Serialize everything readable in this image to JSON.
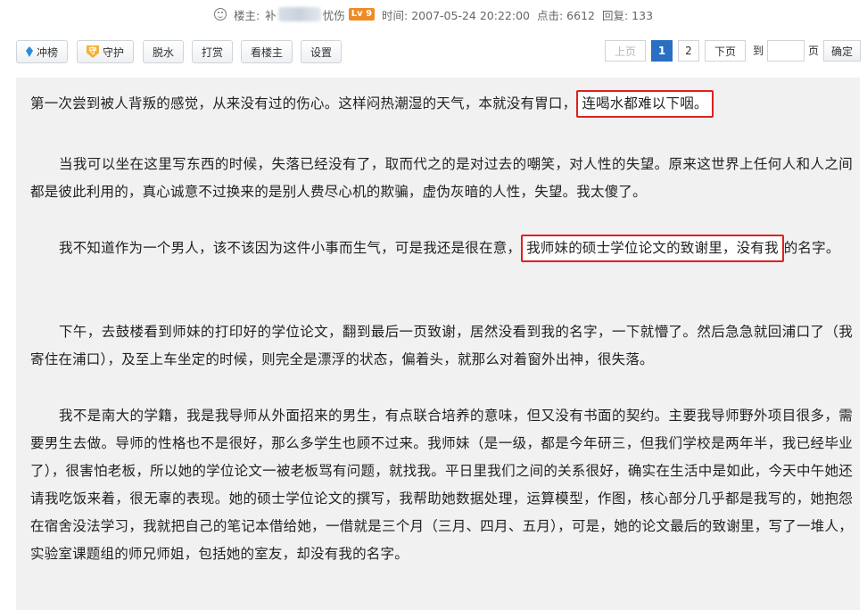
{
  "meta": {
    "author_label": "楼主:",
    "author_prefix": "补",
    "author_suffix": "忧伤",
    "level": "Lv 9",
    "time": "时间: 2007-05-24 20:22:00",
    "clicks": "点击: 6612",
    "replies": "回复: 133"
  },
  "toolbar": {
    "buttons": [
      {
        "label": "冲榜",
        "icon": "gem-icon"
      },
      {
        "label": "守护",
        "icon": "shield-icon",
        "icon_char": "守"
      },
      {
        "label": "脱水"
      },
      {
        "label": "打赏"
      },
      {
        "label": "看楼主"
      },
      {
        "label": "设置"
      }
    ]
  },
  "pager": {
    "prev": "上页",
    "pages": [
      "1",
      "2"
    ],
    "current": "1",
    "next": "下页",
    "goto_prefix": "到",
    "goto_suffix": "页",
    "confirm": "确定"
  },
  "post": {
    "p1_a": "第一次尝到被人背叛的感觉，从来没有过的伤心。这样闷热潮湿的天气，本就没有胃口，",
    "p1_hl": "连喝水都难以下咽。",
    "p2": "当我可以坐在这里写东西的时候，失落已经没有了，取而代之的是对过去的嘲笑，对人性的失望。原来这世界上任何人和人之间都是彼此利用的，真心诚意不过换来的是别人费尽心机的欺骗，虚伪灰暗的人性，失望。我太傻了。",
    "p3_a": "我不知道作为一个男人，该不该因为这件小事而生气，可是我还是很在意，",
    "p3_hl": "我师妹的硕士学位论文的致谢里，没有我",
    "p3_b": "的名字。",
    "p4": "下午，去鼓楼看到师妹的打印好的学位论文，翻到最后一页致谢，居然没看到我的名字，一下就懵了。然后急急就回浦口了（我寄住在浦口），及至上车坐定的时候，则完全是漂浮的状态，偏着头，就那么对着窗外出神，很失落。",
    "p5": "我不是南大的学籍，我是我导师从外面招来的男生，有点联合培养的意味，但又没有书面的契约。主要我导师野外项目很多，需要男生去做。导师的性格也不是很好，那么多学生也顾不过来。我师妹（是一级，都是今年研三，但我们学校是两年半，我已经毕业了），很害怕老板，所以她的学位论文一被老板骂有问题，就找我。平日里我们之间的关系很好，确实在生活中是如此，今天中午她还请我吃饭来着，很无辜的表现。她的硕士学位论文的撰写，我帮助她数据处理，运算模型，作图，核心部分几乎都是我写的，她抱怨在宿舍没法学习，我就把自己的笔记本借给她，一借就是三个月（三月、四月、五月），可是，她的论文最后的致谢里，写了一堆人，实验室课题组的师兄师姐，包括她的室友，却没有我的名字。"
  }
}
